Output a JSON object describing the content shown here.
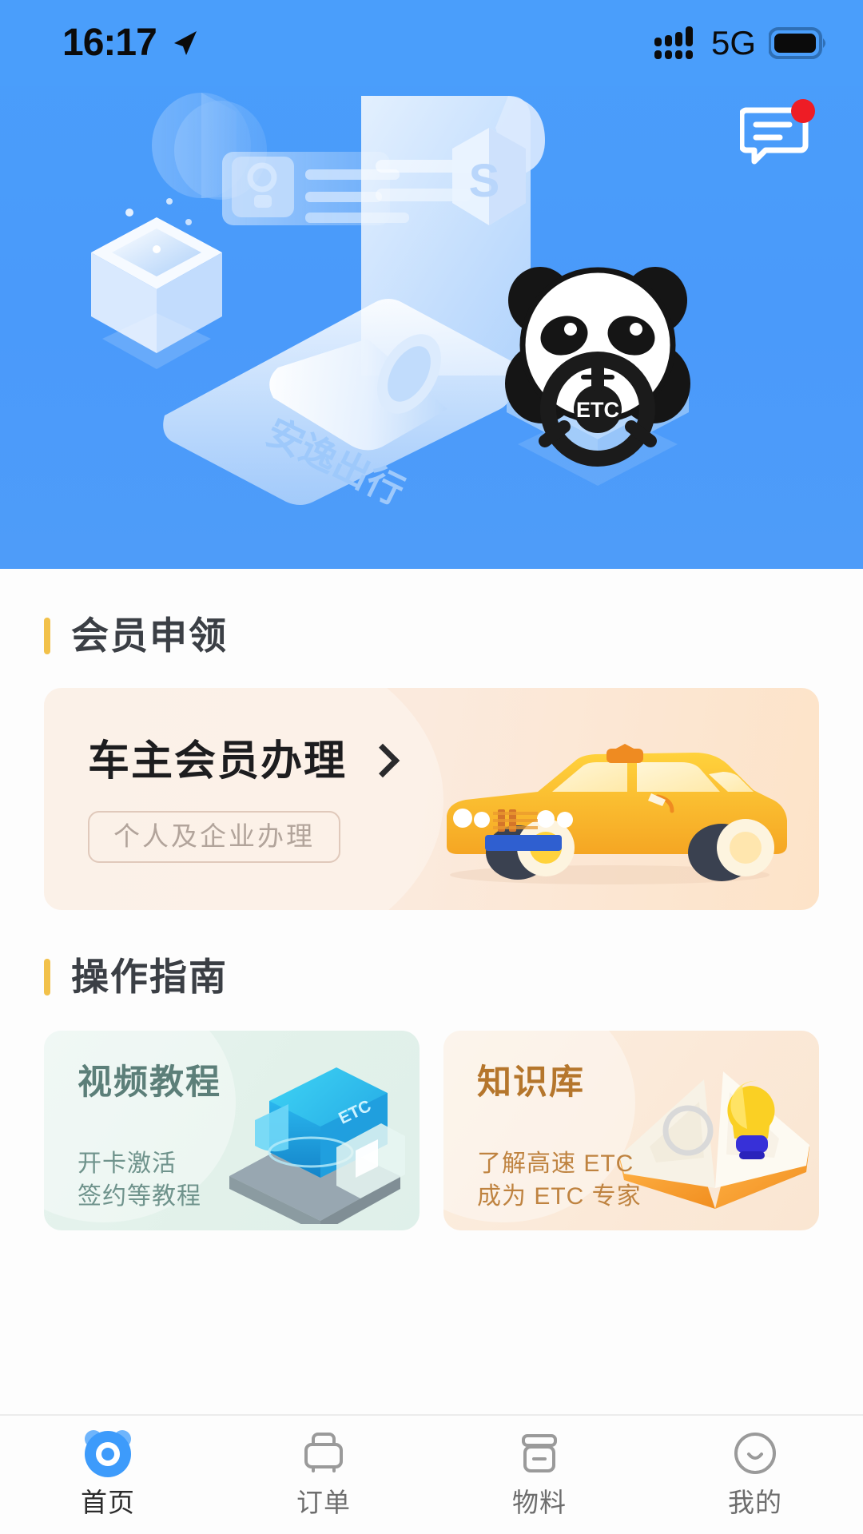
{
  "status_bar": {
    "time": "16:17",
    "location_icon": "location-arrow-icon",
    "signal_icon": "cellular-signal-icon",
    "network": "5G",
    "battery_icon": "battery-full-icon"
  },
  "hero": {
    "message_icon": "message-bubble-icon",
    "has_unread_badge": true,
    "brand_text": "安逸出行",
    "mascot": "panda-etc-mascot",
    "mascot_label": "ETC",
    "badge_letter": "S",
    "background_color": "#4a9efb"
  },
  "sections": {
    "member": {
      "heading": "会员申领",
      "accent_color": "#f2c14a",
      "card": {
        "title": "车主会员办理",
        "chevron_icon": "chevron-right-icon",
        "badge": "个人及企业办理",
        "art": "yellow-car-illustration",
        "background_color": "#faeade"
      }
    },
    "guide": {
      "heading": "操作指南",
      "accent_color": "#f2c14a",
      "cards": [
        {
          "title": "视频教程",
          "subtitle_line1": "开卡激活",
          "subtitle_line2": "签约等教程",
          "art": "etc-device-video-illustration",
          "art_label": "ETC",
          "background_color": "#e3f2ec",
          "title_color": "#5c7f79"
        },
        {
          "title": "知识库",
          "subtitle_line1": "了解高速 ETC",
          "subtitle_line2": "成为 ETC 专家",
          "art": "open-book-lightbulb-illustration",
          "background_color": "#fbeade",
          "title_color": "#b5762c"
        }
      ]
    }
  },
  "tabbar": {
    "items": [
      {
        "label": "首页",
        "icon": "panda-home-icon",
        "active": true
      },
      {
        "label": "订单",
        "icon": "order-bag-icon",
        "active": false
      },
      {
        "label": "物料",
        "icon": "material-box-icon",
        "active": false
      },
      {
        "label": "我的",
        "icon": "profile-smile-icon",
        "active": false
      }
    ],
    "active_color": "#3d9bfb",
    "inactive_color": "#9a9a9a"
  }
}
